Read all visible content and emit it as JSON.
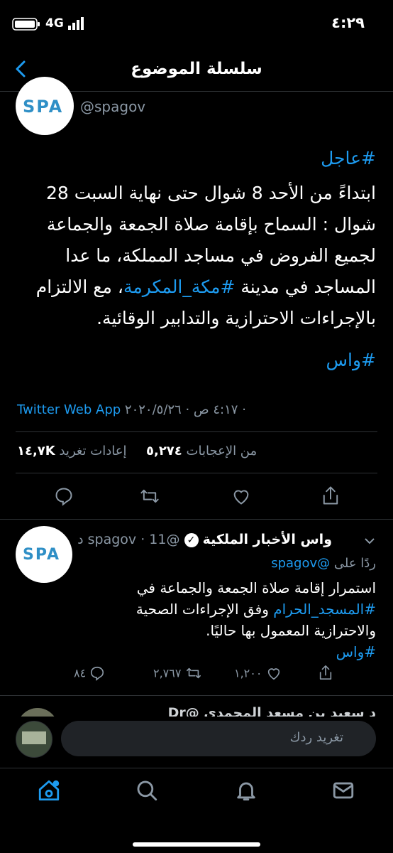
{
  "status_bar": {
    "time": "٤:٢٩",
    "network": "4G"
  },
  "header": {
    "title": "سلسلة الموضوع"
  },
  "main_tweet": {
    "avatar_text": "SPA",
    "handle": "@spagov",
    "hashtag_top": "#عاجل",
    "body_lines": [
      "ابتداءً من الأحد 8 شوال حتى نهاية السبت 28",
      "شوال : السماح بإقامة صلاة الجمعة والجماعة",
      "لجميع الفروض في مساجد المملكة، ما عدا",
      "المساجد في مدينة ",
      "#مكة_المكرمة",
      "، مع الالتزام",
      "بالإجراءات الاحترازية والتدابير الوقائية."
    ],
    "hashtag_bottom": "#واس",
    "meta_time": "٤:١٧ ص · ٢٠٢٠/٥/٢٦ · ",
    "meta_source": "Twitter Web App",
    "retweets_value": "١٤,٧K",
    "retweets_label": "إعادات تغريد",
    "likes_value": "٥,٢٧٤",
    "likes_label": "من الإعجابات"
  },
  "reply_tweet": {
    "name": "واس الأخبار الملكية",
    "handle": "@spagov",
    "time": "11 د",
    "replying_to_prefix": "ردًا على",
    "replying_to_handle": "@spagov",
    "line1": "استمرار إقامة صلاة الجمعة والجماعة في",
    "line2_tag": "#المسجد_الحرام",
    "line2_text": " وفق الإجراءات الصحية",
    "line3": "والاحترازية المعمول بها حاليًا.",
    "hashtag": "#واس",
    "reply_count": "٨٤",
    "retweet_count": "٢,٧٦٧",
    "like_count": "١,٢٠٠"
  },
  "partial_tweet": {
    "text": "د سعيد بن مسعد المحمدي @Dr"
  },
  "compose": {
    "placeholder": "تغريد ردك"
  },
  "colors": {
    "accent": "#1d9bf0",
    "muted": "#8b98a5",
    "divider": "#2f3336",
    "background": "#000000"
  }
}
